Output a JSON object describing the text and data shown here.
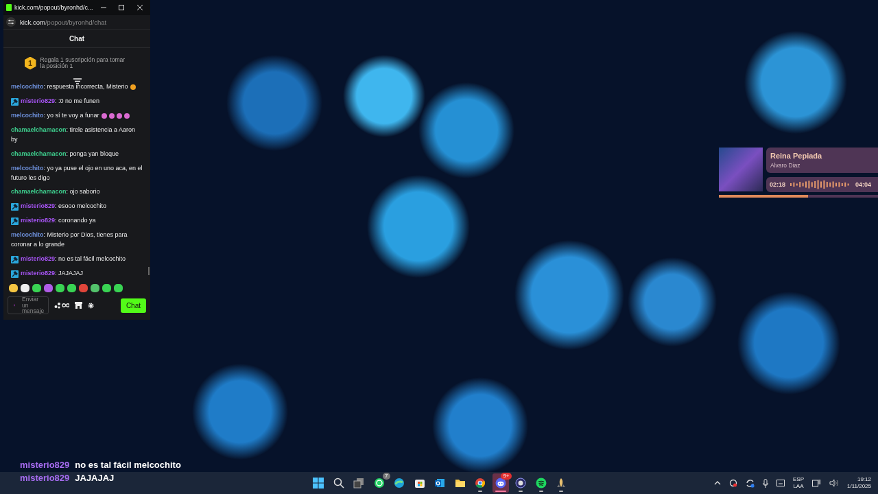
{
  "browser_window": {
    "title": "kick.com/popout/byronhd/c...",
    "url_host": "kick.com",
    "url_path": "/popout/byronhd/chat",
    "header": "Chat",
    "promo_rank": "1",
    "promo": "Regala 1 suscripción para tomar la posición 1",
    "messages": [
      {
        "user": "melcochito",
        "color": "#6d8fd9",
        "moderator": false,
        "text": ": respuesta incorrecta, Misterio",
        "emotes": [
          {
            "color": "#f0a020"
          }
        ]
      },
      {
        "user": "misterio829",
        "color": "#a855f7",
        "moderator": true,
        "text": ": :0 no me funen"
      },
      {
        "user": "melcochito",
        "color": "#6d8fd9",
        "moderator": false,
        "text": ": yo sí te voy a funar",
        "emotes": [
          {
            "color": "#d96ad0"
          },
          {
            "color": "#d96ad0"
          },
          {
            "color": "#d96ad0"
          },
          {
            "color": "#d96ad0"
          }
        ]
      },
      {
        "user": "chamaelchamacon",
        "color": "#3ecf8e",
        "moderator": false,
        "text": ": tirele asistencia a Aaron by"
      },
      {
        "user": "chamaelchamacon",
        "color": "#3ecf8e",
        "moderator": false,
        "text": ": ponga yan bloque"
      },
      {
        "user": "melcochito",
        "color": "#6d8fd9",
        "moderator": false,
        "text": ": yo ya puse el ojo en uno aca, en el futuro les digo"
      },
      {
        "user": "chamaelchamacon",
        "color": "#3ecf8e",
        "moderator": false,
        "text": ": ojo saborio"
      },
      {
        "user": "misterio829",
        "color": "#a855f7",
        "moderator": true,
        "text": ": esooo melcochito"
      },
      {
        "user": "misterio829",
        "color": "#a855f7",
        "moderator": true,
        "text": ": coronando ya"
      },
      {
        "user": "melcochito",
        "color": "#6d8fd9",
        "moderator": false,
        "text": ": Misterio por Dios, tienes para coronar a lo grande"
      },
      {
        "user": "misterio829",
        "color": "#a855f7",
        "moderator": true,
        "text": ": no es tal fácil melcochito"
      },
      {
        "user": "misterio829",
        "color": "#a855f7",
        "moderator": true,
        "text": ": JAJAJAJ"
      }
    ],
    "input_placeholder": "Enviar un mensaje",
    "send_button": "Chat"
  },
  "music": {
    "title": "Reina Pepiada",
    "artist": "Alvaro Diaz",
    "elapsed": "02:18",
    "duration": "04:04",
    "level": 0.56
  },
  "overlay_chat": [
    {
      "user": "misterio829",
      "text": "no es tal fácil melcochito"
    },
    {
      "user": "misterio829",
      "text": "JAJAJAJ"
    }
  ],
  "taskbar": {
    "apps": [
      {
        "kind": "start",
        "running": false,
        "selected": false
      },
      {
        "kind": "search",
        "running": false,
        "selected": false
      },
      {
        "kind": "taskview",
        "running": false,
        "selected": false
      },
      {
        "kind": "whatsapp",
        "badge": "7",
        "running": false,
        "selected": false
      },
      {
        "kind": "edge",
        "running": false,
        "selected": false
      },
      {
        "kind": "store",
        "running": false,
        "selected": false
      },
      {
        "kind": "outlook",
        "running": false,
        "selected": false
      },
      {
        "kind": "folder",
        "running": false,
        "selected": false
      },
      {
        "kind": "chrome",
        "running": true,
        "selected": false
      },
      {
        "kind": "discord",
        "badge": "9+",
        "running": true,
        "selected": true
      },
      {
        "kind": "obs",
        "running": true,
        "selected": false
      },
      {
        "kind": "spotify",
        "running": true,
        "selected": false
      },
      {
        "kind": "rocket",
        "running": true,
        "selected": false
      }
    ],
    "language": "ESP",
    "layout": "LAA",
    "time": "19:12",
    "date": "1/11/2025"
  }
}
